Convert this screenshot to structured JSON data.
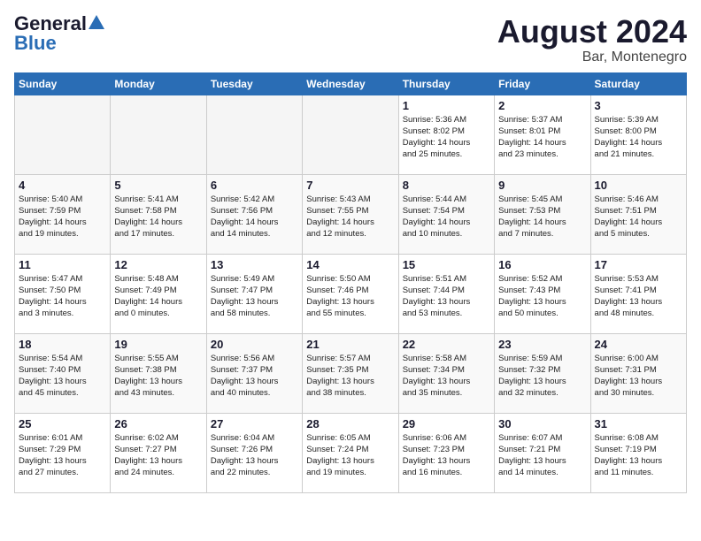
{
  "header": {
    "logo_general": "General",
    "logo_blue": "Blue",
    "month_title": "August 2024",
    "location": "Bar, Montenegro"
  },
  "days_of_week": [
    "Sunday",
    "Monday",
    "Tuesday",
    "Wednesday",
    "Thursday",
    "Friday",
    "Saturday"
  ],
  "weeks": [
    [
      {
        "day": "",
        "empty": true
      },
      {
        "day": "",
        "empty": true
      },
      {
        "day": "",
        "empty": true
      },
      {
        "day": "",
        "empty": true
      },
      {
        "day": "1",
        "lines": [
          "Sunrise: 5:36 AM",
          "Sunset: 8:02 PM",
          "Daylight: 14 hours",
          "and 25 minutes."
        ]
      },
      {
        "day": "2",
        "lines": [
          "Sunrise: 5:37 AM",
          "Sunset: 8:01 PM",
          "Daylight: 14 hours",
          "and 23 minutes."
        ]
      },
      {
        "day": "3",
        "lines": [
          "Sunrise: 5:39 AM",
          "Sunset: 8:00 PM",
          "Daylight: 14 hours",
          "and 21 minutes."
        ]
      }
    ],
    [
      {
        "day": "4",
        "lines": [
          "Sunrise: 5:40 AM",
          "Sunset: 7:59 PM",
          "Daylight: 14 hours",
          "and 19 minutes."
        ]
      },
      {
        "day": "5",
        "lines": [
          "Sunrise: 5:41 AM",
          "Sunset: 7:58 PM",
          "Daylight: 14 hours",
          "and 17 minutes."
        ]
      },
      {
        "day": "6",
        "lines": [
          "Sunrise: 5:42 AM",
          "Sunset: 7:56 PM",
          "Daylight: 14 hours",
          "and 14 minutes."
        ]
      },
      {
        "day": "7",
        "lines": [
          "Sunrise: 5:43 AM",
          "Sunset: 7:55 PM",
          "Daylight: 14 hours",
          "and 12 minutes."
        ]
      },
      {
        "day": "8",
        "lines": [
          "Sunrise: 5:44 AM",
          "Sunset: 7:54 PM",
          "Daylight: 14 hours",
          "and 10 minutes."
        ]
      },
      {
        "day": "9",
        "lines": [
          "Sunrise: 5:45 AM",
          "Sunset: 7:53 PM",
          "Daylight: 14 hours",
          "and 7 minutes."
        ]
      },
      {
        "day": "10",
        "lines": [
          "Sunrise: 5:46 AM",
          "Sunset: 7:51 PM",
          "Daylight: 14 hours",
          "and 5 minutes."
        ]
      }
    ],
    [
      {
        "day": "11",
        "lines": [
          "Sunrise: 5:47 AM",
          "Sunset: 7:50 PM",
          "Daylight: 14 hours",
          "and 3 minutes."
        ]
      },
      {
        "day": "12",
        "lines": [
          "Sunrise: 5:48 AM",
          "Sunset: 7:49 PM",
          "Daylight: 14 hours",
          "and 0 minutes."
        ]
      },
      {
        "day": "13",
        "lines": [
          "Sunrise: 5:49 AM",
          "Sunset: 7:47 PM",
          "Daylight: 13 hours",
          "and 58 minutes."
        ]
      },
      {
        "day": "14",
        "lines": [
          "Sunrise: 5:50 AM",
          "Sunset: 7:46 PM",
          "Daylight: 13 hours",
          "and 55 minutes."
        ]
      },
      {
        "day": "15",
        "lines": [
          "Sunrise: 5:51 AM",
          "Sunset: 7:44 PM",
          "Daylight: 13 hours",
          "and 53 minutes."
        ]
      },
      {
        "day": "16",
        "lines": [
          "Sunrise: 5:52 AM",
          "Sunset: 7:43 PM",
          "Daylight: 13 hours",
          "and 50 minutes."
        ]
      },
      {
        "day": "17",
        "lines": [
          "Sunrise: 5:53 AM",
          "Sunset: 7:41 PM",
          "Daylight: 13 hours",
          "and 48 minutes."
        ]
      }
    ],
    [
      {
        "day": "18",
        "lines": [
          "Sunrise: 5:54 AM",
          "Sunset: 7:40 PM",
          "Daylight: 13 hours",
          "and 45 minutes."
        ]
      },
      {
        "day": "19",
        "lines": [
          "Sunrise: 5:55 AM",
          "Sunset: 7:38 PM",
          "Daylight: 13 hours",
          "and 43 minutes."
        ]
      },
      {
        "day": "20",
        "lines": [
          "Sunrise: 5:56 AM",
          "Sunset: 7:37 PM",
          "Daylight: 13 hours",
          "and 40 minutes."
        ]
      },
      {
        "day": "21",
        "lines": [
          "Sunrise: 5:57 AM",
          "Sunset: 7:35 PM",
          "Daylight: 13 hours",
          "and 38 minutes."
        ]
      },
      {
        "day": "22",
        "lines": [
          "Sunrise: 5:58 AM",
          "Sunset: 7:34 PM",
          "Daylight: 13 hours",
          "and 35 minutes."
        ]
      },
      {
        "day": "23",
        "lines": [
          "Sunrise: 5:59 AM",
          "Sunset: 7:32 PM",
          "Daylight: 13 hours",
          "and 32 minutes."
        ]
      },
      {
        "day": "24",
        "lines": [
          "Sunrise: 6:00 AM",
          "Sunset: 7:31 PM",
          "Daylight: 13 hours",
          "and 30 minutes."
        ]
      }
    ],
    [
      {
        "day": "25",
        "lines": [
          "Sunrise: 6:01 AM",
          "Sunset: 7:29 PM",
          "Daylight: 13 hours",
          "and 27 minutes."
        ]
      },
      {
        "day": "26",
        "lines": [
          "Sunrise: 6:02 AM",
          "Sunset: 7:27 PM",
          "Daylight: 13 hours",
          "and 24 minutes."
        ]
      },
      {
        "day": "27",
        "lines": [
          "Sunrise: 6:04 AM",
          "Sunset: 7:26 PM",
          "Daylight: 13 hours",
          "and 22 minutes."
        ]
      },
      {
        "day": "28",
        "lines": [
          "Sunrise: 6:05 AM",
          "Sunset: 7:24 PM",
          "Daylight: 13 hours",
          "and 19 minutes."
        ]
      },
      {
        "day": "29",
        "lines": [
          "Sunrise: 6:06 AM",
          "Sunset: 7:23 PM",
          "Daylight: 13 hours",
          "and 16 minutes."
        ]
      },
      {
        "day": "30",
        "lines": [
          "Sunrise: 6:07 AM",
          "Sunset: 7:21 PM",
          "Daylight: 13 hours",
          "and 14 minutes."
        ]
      },
      {
        "day": "31",
        "lines": [
          "Sunrise: 6:08 AM",
          "Sunset: 7:19 PM",
          "Daylight: 13 hours",
          "and 11 minutes."
        ]
      }
    ]
  ]
}
